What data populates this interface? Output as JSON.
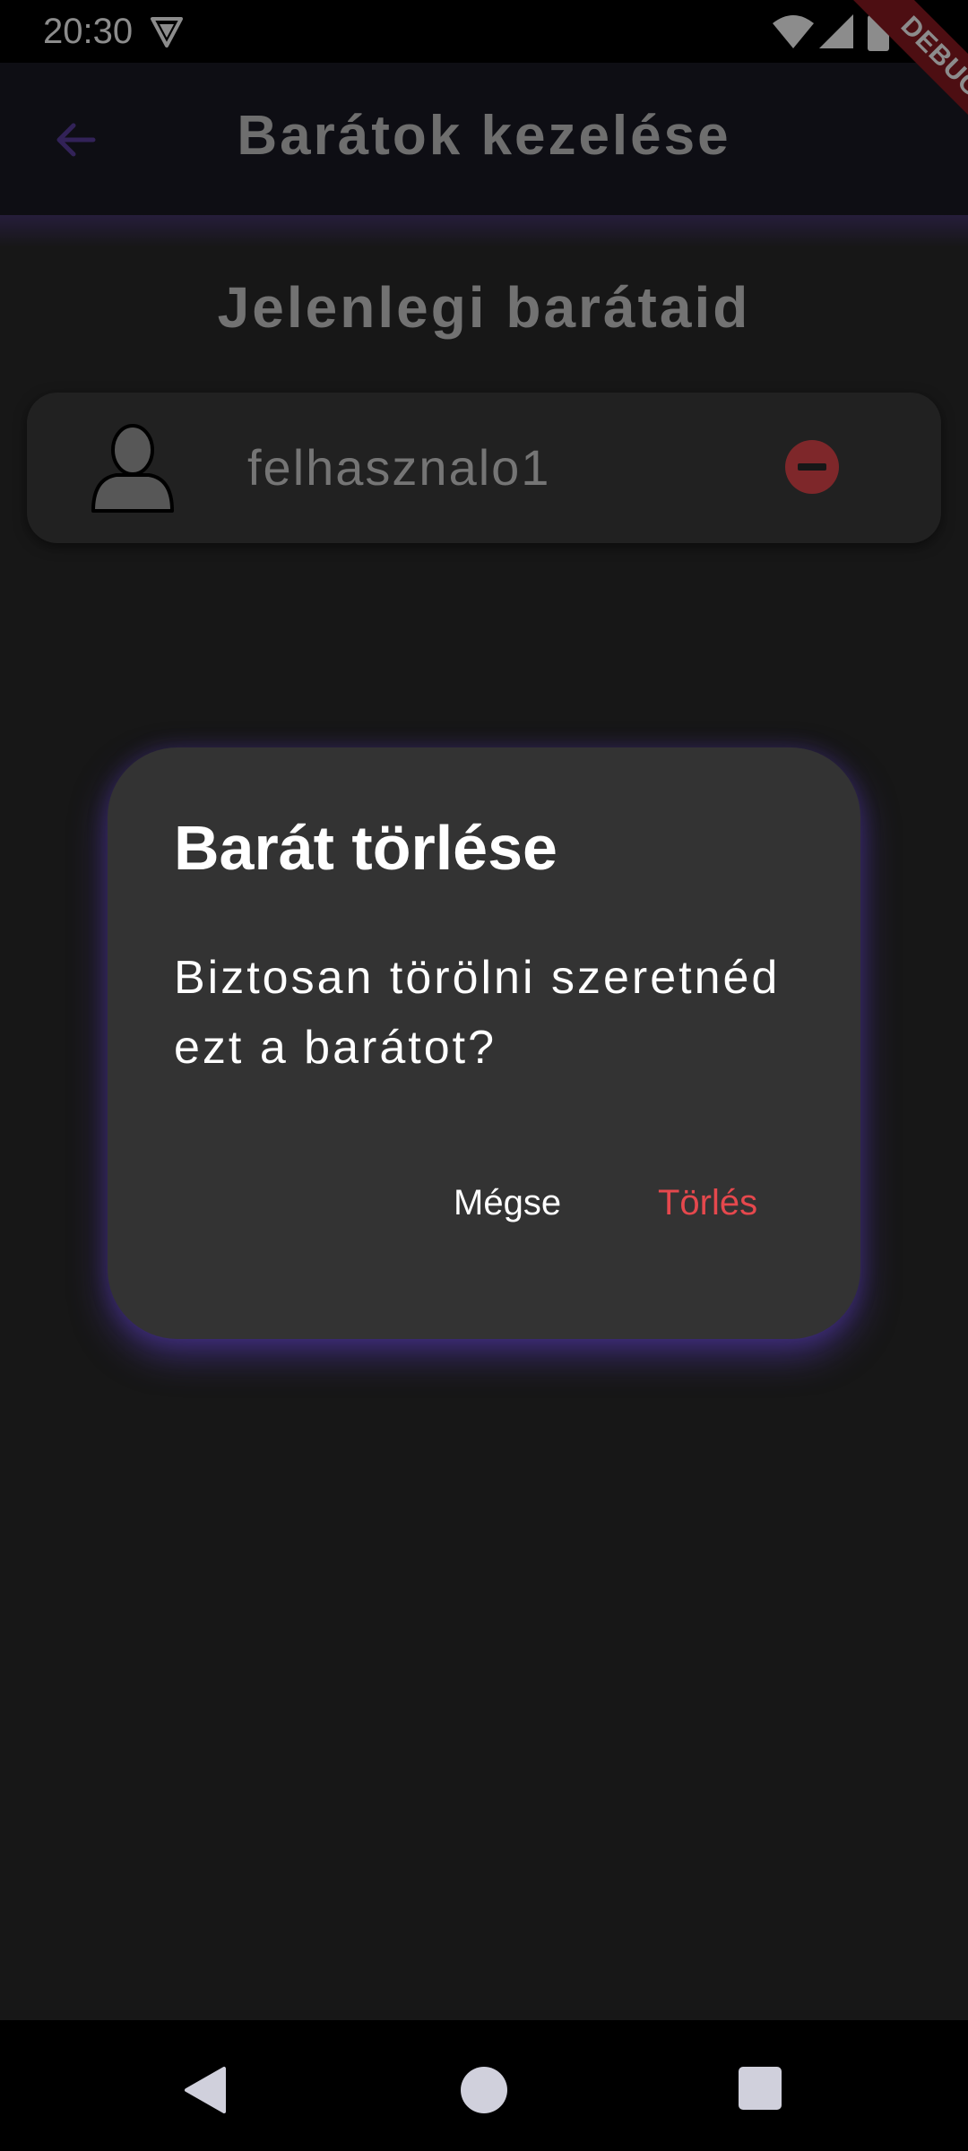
{
  "status_bar": {
    "time": "20:30"
  },
  "debug_banner": {
    "label": "DEBUG"
  },
  "app_bar": {
    "title": "Barátok kezelése"
  },
  "section": {
    "title": "Jelenlegi barátaid"
  },
  "friends": [
    {
      "username": "felhasznalo1"
    }
  ],
  "dialog": {
    "title": "Barát törlése",
    "message": "Biztosan törölni szeretnéd ezt a barátot?",
    "cancel_label": "Mégse",
    "delete_label": "Törlés"
  },
  "colors": {
    "accent": "#5b3fa0",
    "danger": "#e5484d",
    "dialog_background": "#333333",
    "page_background": "#2a2a2a"
  },
  "icons": {
    "back": "arrow-left-icon",
    "remove": "minus-circle-icon",
    "avatar": "person-icon",
    "nav_back": "triangle-back-icon",
    "nav_home": "circle-home-icon",
    "nav_recent": "square-recents-icon"
  }
}
